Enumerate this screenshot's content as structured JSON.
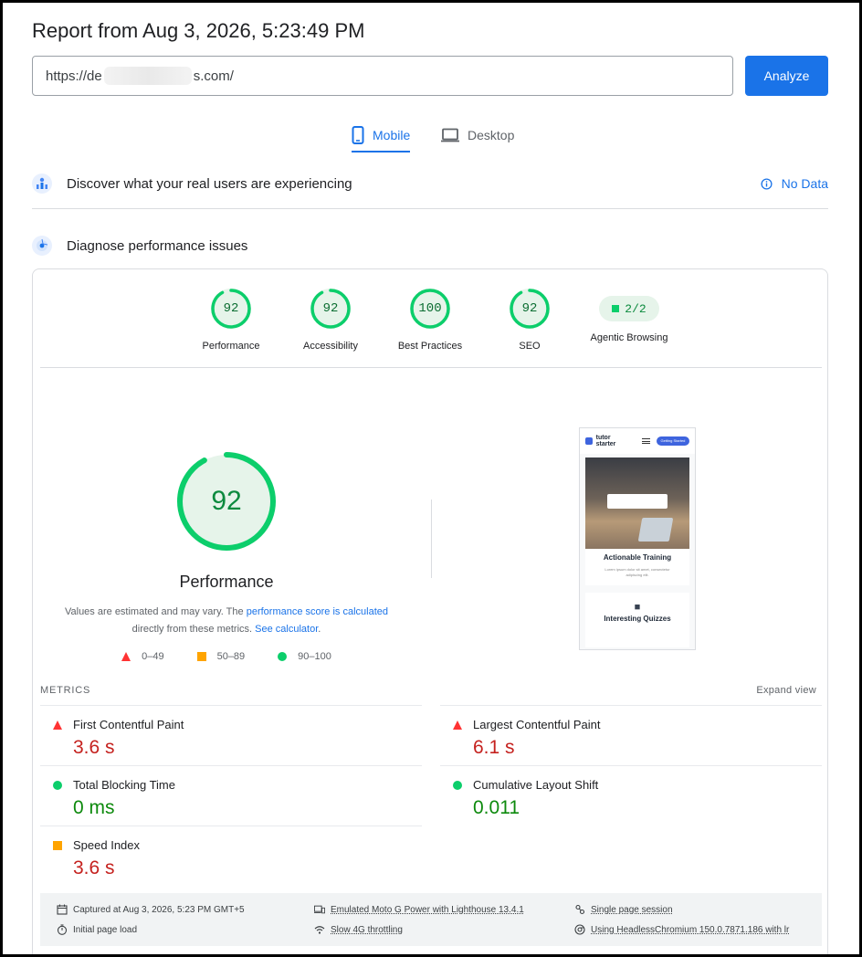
{
  "report_title": "Report from Aug 3, 2026, 5:23:49 PM",
  "url": {
    "prefix": "https://de",
    "suffix": "s.com/"
  },
  "analyze_label": "Analyze",
  "tabs": {
    "mobile": "Mobile",
    "desktop": "Desktop"
  },
  "field_data": {
    "title": "Discover what your real users are experiencing",
    "status": "No Data"
  },
  "diagnose": {
    "title": "Diagnose performance issues"
  },
  "scores": [
    {
      "label": "Performance",
      "value": "92"
    },
    {
      "label": "Accessibility",
      "value": "92"
    },
    {
      "label": "Best Practices",
      "value": "100"
    },
    {
      "label": "SEO",
      "value": "92"
    }
  ],
  "agentic": {
    "label": "Agentic Browsing",
    "value": "2/2"
  },
  "performance": {
    "score": "92",
    "score_fraction": 0.92,
    "title": "Performance",
    "desc_1": "Values are estimated and may vary. The ",
    "desc_link_1": "performance score is calculated",
    "desc_2": "directly from these metrics. ",
    "desc_link_2": "See calculator",
    "desc_3": "."
  },
  "legend": {
    "poor": "0–49",
    "average": "50–89",
    "good": "90–100"
  },
  "screenshot": {
    "logo": "tutor starter",
    "button": "Getting Started",
    "card1_title": "Actionable Training",
    "card1_text": "Lorem ipsum dolor sit amet, consectetur adipiscing elit.",
    "card2_title": "Interesting Quizzes"
  },
  "metrics_header": {
    "label": "METRICS",
    "expand": "Expand view"
  },
  "metrics": [
    {
      "name": "First Contentful Paint",
      "value": "3.6 s",
      "status": "poor"
    },
    {
      "name": "Largest Contentful Paint",
      "value": "6.1 s",
      "status": "poor"
    },
    {
      "name": "Total Blocking Time",
      "value": "0 ms",
      "status": "good"
    },
    {
      "name": "Cumulative Layout Shift",
      "value": "0.011",
      "status": "good"
    },
    {
      "name": "Speed Index",
      "value": "3.6 s",
      "status": "average"
    }
  ],
  "footer": {
    "captured": "Captured at Aug 3, 2026, 5:23 PM GMT+5",
    "page_load": "Initial page load",
    "device": "Emulated Moto G Power with Lighthouse 13.4.1",
    "throttling": "Slow 4G throttling",
    "session": "Single page session",
    "browser": "Using HeadlessChromium 150.0.7871.186 with lr"
  },
  "colors": {
    "accent": "#1a73e8",
    "good": "#0cce6b",
    "average": "#ffa400",
    "poor": "#ff3333"
  }
}
